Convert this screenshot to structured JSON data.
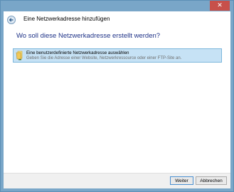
{
  "window": {
    "title": "Eine Netzwerkadresse hinzufügen",
    "close_glyph": "✕"
  },
  "main": {
    "heading": "Wo soll diese Netzwerkadresse erstellt werden?",
    "options": [
      {
        "title": "Eine benutzerdefinierte Netzwerkadresse auswählen",
        "description": "Geben Sie die Adresse einer Website, Netzwerkressource oder einer FTP-Site an.",
        "icon": "folder-network-icon"
      }
    ]
  },
  "footer": {
    "next_label": "Weiter",
    "cancel_label": "Abbrechen"
  },
  "colors": {
    "frame": "#79a6c8",
    "close": "#c7504a",
    "heading": "#1e3287",
    "selection": "#c6e2f5"
  }
}
